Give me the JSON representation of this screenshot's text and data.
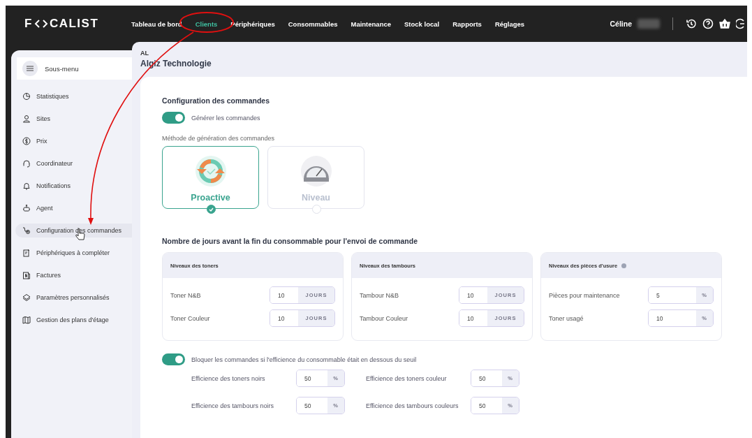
{
  "topbar": {
    "logo_left": "F",
    "logo_right": "CALIST",
    "nav": [
      {
        "label": "Tableau de bord",
        "selected": false
      },
      {
        "label": "Clients",
        "selected": true
      },
      {
        "label": "Périphériques",
        "selected": false
      },
      {
        "label": "Consommables",
        "selected": false
      },
      {
        "label": "Maintenance",
        "selected": false
      },
      {
        "label": "Stock local",
        "selected": false
      },
      {
        "label": "Rapports",
        "selected": false
      },
      {
        "label": "Réglages",
        "selected": false
      }
    ],
    "user": "Céline"
  },
  "sidebar": {
    "title": "Sous-menu",
    "items": [
      {
        "label": "Statistiques",
        "selected": false
      },
      {
        "label": "Sites",
        "selected": false
      },
      {
        "label": "Prix",
        "selected": false
      },
      {
        "label": "Coordinateur",
        "selected": false
      },
      {
        "label": "Notifications",
        "selected": false
      },
      {
        "label": "Agent",
        "selected": false
      },
      {
        "label": "Configuration des commandes",
        "selected": true
      },
      {
        "label": "Périphériques à compléter",
        "selected": false
      },
      {
        "label": "Factures",
        "selected": false
      },
      {
        "label": "Paramètres personnalisés",
        "selected": false
      },
      {
        "label": "Gestion des plans d'étage",
        "selected": false
      }
    ]
  },
  "client": {
    "code": "AL",
    "name": "Algiz Technologie"
  },
  "config": {
    "title": "Configuration des commandes",
    "toggle": {
      "label": "Générer les commandes",
      "on": true
    },
    "method_label": "Méthode de génération des commandes",
    "methods": [
      {
        "label": "Proactive",
        "kind": "cycle",
        "selected": true
      },
      {
        "label": "Niveau",
        "kind": "gauge",
        "selected": false
      }
    ]
  },
  "days": {
    "title": "Nombre de jours avant la fin du consommable pour l'envoi de commande",
    "cards": [
      {
        "title": "Niveaux des toners",
        "info": false,
        "rows": [
          {
            "label": "Toner N&B",
            "value": "10",
            "unit": "JOURS"
          },
          {
            "label": "Toner Couleur",
            "value": "10",
            "unit": "JOURS"
          }
        ]
      },
      {
        "title": "Niveaux des tambours",
        "info": false,
        "rows": [
          {
            "label": "Tambour N&B",
            "value": "10",
            "unit": "JOURS"
          },
          {
            "label": "Tambour Couleur",
            "value": "10",
            "unit": "JOURS"
          }
        ]
      },
      {
        "title": "Niveaux des pièces d'usure",
        "info": true,
        "rows": [
          {
            "label": "Pièces pour maintenance",
            "value": "5",
            "unit": "%"
          },
          {
            "label": "Toner usagé",
            "value": "10",
            "unit": "%"
          }
        ]
      }
    ]
  },
  "block": {
    "toggle": {
      "label": "Bloquer les commandes si l'efficience du consommable était en dessous du seuil",
      "on": true
    },
    "fields": [
      {
        "label": "Efficience des toners noirs",
        "value": "50",
        "unit": "%"
      },
      {
        "label": "Efficience des toners couleur",
        "value": "50",
        "unit": "%"
      },
      {
        "label": "Efficience des tambours noirs",
        "value": "50",
        "unit": "%"
      },
      {
        "label": "Efficience des tambours couleurs",
        "value": "50",
        "unit": "%"
      }
    ]
  }
}
